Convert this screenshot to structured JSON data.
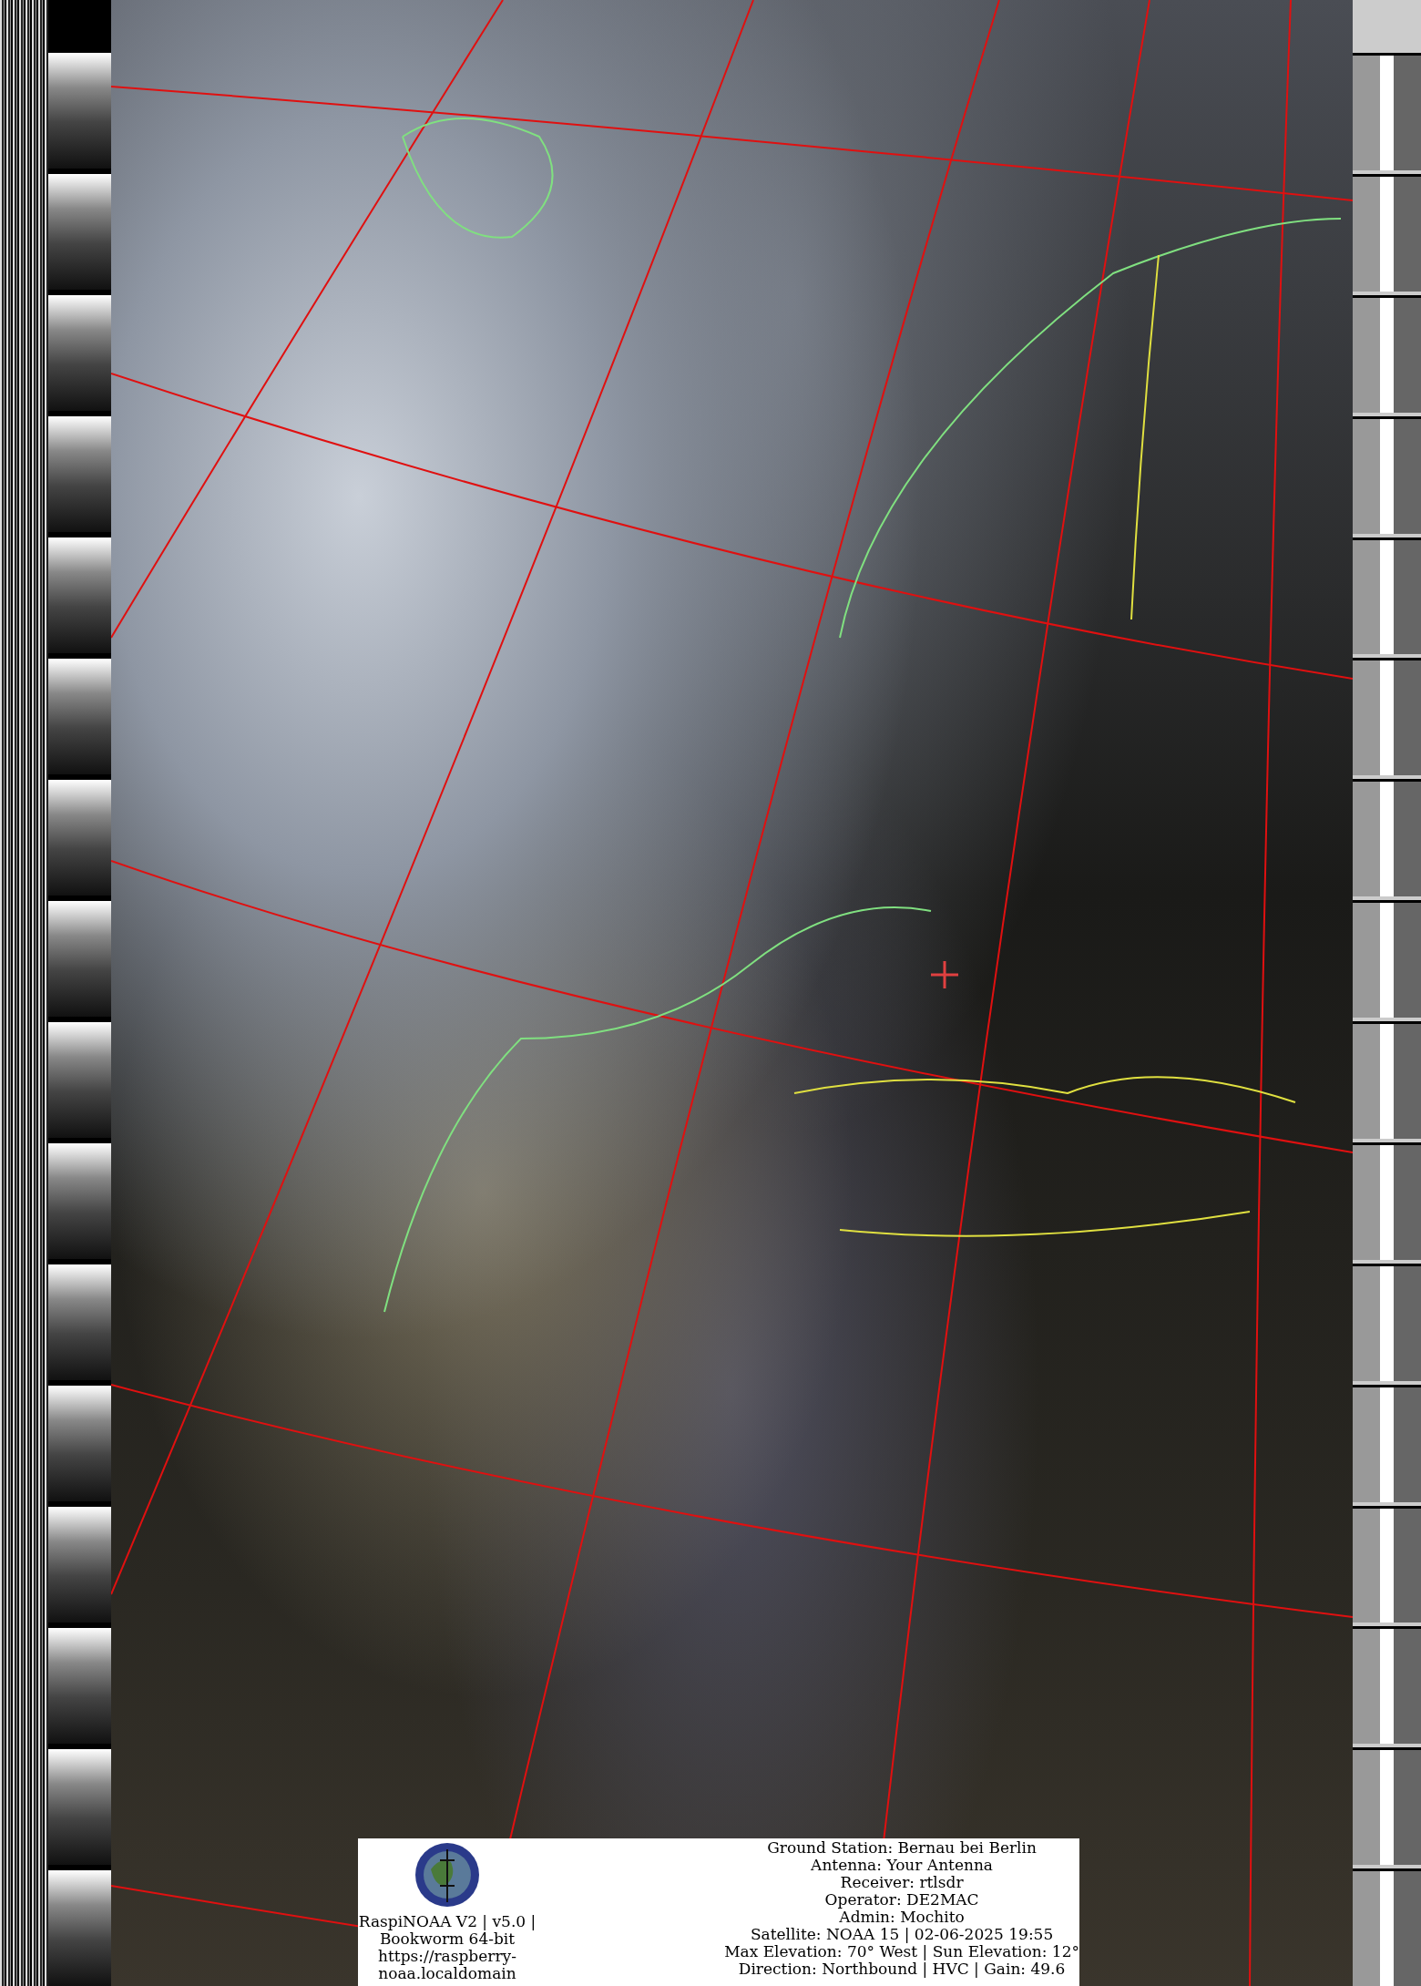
{
  "caption": {
    "station_lines": [
      "RaspiNOAA V2 | v5.0 |",
      "Bookworm 64-bit",
      "https://raspberry-",
      "noaa.localdomain"
    ],
    "pass_lines": [
      "Ground Station: Bernau bei Berlin",
      "Antenna: Your Antenna",
      "Receiver: rtlsdr",
      "Operator: DE2MAC",
      "Admin: Mochito",
      "Satellite: NOAA 15 | 02-06-2025 19:55",
      "Max Elevation: 70° West | Sun Elevation: 12°",
      "Direction: Northbound | HVC | Gain: 49.6"
    ]
  }
}
